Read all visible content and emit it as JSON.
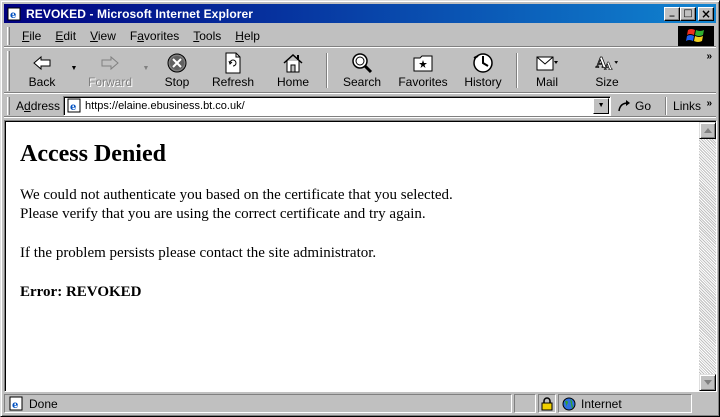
{
  "window": {
    "title": "REVOKED - Microsoft Internet Explorer",
    "minimize_glyph": "_",
    "maximize_glyph": "□",
    "close_glyph": "×"
  },
  "menu": {
    "file": {
      "key": "F",
      "rest": "ile"
    },
    "edit": {
      "key": "E",
      "rest": "dit"
    },
    "view": {
      "key": "V",
      "rest": "iew"
    },
    "favorites": {
      "pre": "F",
      "key": "a",
      "rest": "vorites"
    },
    "tools": {
      "key": "T",
      "rest": "ools"
    },
    "help": {
      "key": "H",
      "rest": "elp"
    }
  },
  "toolbar": {
    "back": "Back",
    "forward": "Forward",
    "stop": "Stop",
    "refresh": "Refresh",
    "home": "Home",
    "search": "Search",
    "favorites": "Favorites",
    "history": "History",
    "mail": "Mail",
    "size": "Size",
    "more": "»",
    "drop": "▼"
  },
  "address": {
    "label_key": "d",
    "label_pre": "A",
    "label_rest": "dress",
    "url": "https://elaine.ebusiness.bt.co.uk/",
    "go": "Go",
    "links": "Links",
    "more": "»"
  },
  "page": {
    "heading": "Access Denied",
    "line1": "We could not authenticate you based on the certificate that you selected.",
    "line2": "Please verify that you are using the correct certificate and try again.",
    "line3": "If the problem persists please contact the site administrator.",
    "error": "Error: REVOKED"
  },
  "status": {
    "text": "Done",
    "zone": "Internet"
  },
  "colors": {
    "titlebar_start": "#000080",
    "titlebar_end": "#1084d0",
    "chrome": "#c0c0c0"
  }
}
